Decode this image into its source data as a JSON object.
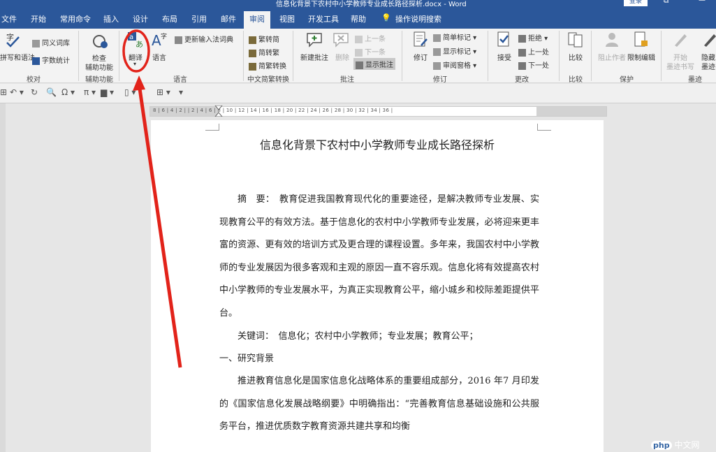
{
  "window": {
    "title": "信息化背景下农村中小学教师专业成长路径探析.docx - Word",
    "login": "登录",
    "restore": "⧉",
    "minimize": "—"
  },
  "tabs": [
    "文件",
    "开始",
    "常用命令",
    "插入",
    "设计",
    "布局",
    "引用",
    "邮件",
    "审阅",
    "视图",
    "开发工具",
    "帮助",
    "操作说明搜索"
  ],
  "ribbon": {
    "proofing": {
      "abc": "拼写和语法",
      "thesaurus": "同义词库",
      "wordcount": "字数统计",
      "label": "校对"
    },
    "access": {
      "check": "检查",
      "check2": "辅助功能",
      "label": "辅助功能"
    },
    "language": {
      "translate": "翻译",
      "lang": "语言",
      "update_ime": "更新输入法词典",
      "label": "语言"
    },
    "chinese": {
      "t2s": "繁转简",
      "s2t": "简转繁",
      "convert": "简繁转换",
      "label": "中文简繁转换"
    },
    "comments": {
      "new": "新建批注",
      "delete": "删除",
      "prev": "上一条",
      "next": "下一条",
      "show": "显示批注",
      "label": "批注"
    },
    "tracking": {
      "track": "修订",
      "markup": "简单标记",
      "show_markup": "显示标记",
      "pane": "审阅窗格",
      "label": "修订"
    },
    "changes": {
      "accept": "接受",
      "reject": "拒绝",
      "prev": "上一处",
      "next": "下一处",
      "label": "更改"
    },
    "compare": {
      "compare": "比较",
      "label": "比较"
    },
    "protect": {
      "block": "阻止作者",
      "restrict": "限制编辑",
      "label": "保护"
    },
    "ink": {
      "start1": "开始",
      "start2": "墨迹书写",
      "hide1": "隐藏",
      "hide2": "墨迹",
      "label": "墨迹"
    }
  },
  "ruler": "8 | 6 | 4 | 2 |   | 2 | 4 | 6 | 8 | 10 | 12 | 14 | 16 | 18 | 20 | 22 | 24 | 26 | 28 | 30 | 32 | 34 | 36 |",
  "doc": {
    "title": "信息化背景下农村中小学教师专业成长路径探析",
    "abstract": "摘　要：　教育促进我国教育现代化的重要途径，是解决教师专业发展、实现教育公平的有效方法。基于信息化的农村中小学教师专业发展，必将迎来更丰富的资源、更有效的培训方式及更合理的课程设置。多年来，我国农村中小学教师的专业发展因为很多客观和主观的原因一直不容乐观。信息化将有效提高农村中小学教师的专业发展水平，为真正实现教育公平，缩小城乡和校际差距提供平台。",
    "keywords": "关键词：　信息化；农村中小学教师；专业发展；教育公平；",
    "section1": "一、研究背景",
    "body": "推进教育信息化是国家信息化战略体系的重要组成部分，2016 年7 月印发的《国家信息化发展战略纲要》中明确指出：“完善教育信息基础设施和公共服务平台，推进优质数字教育资源共建共享和均衡"
  },
  "watermark": {
    "logo": "php",
    "text": "中文网"
  }
}
